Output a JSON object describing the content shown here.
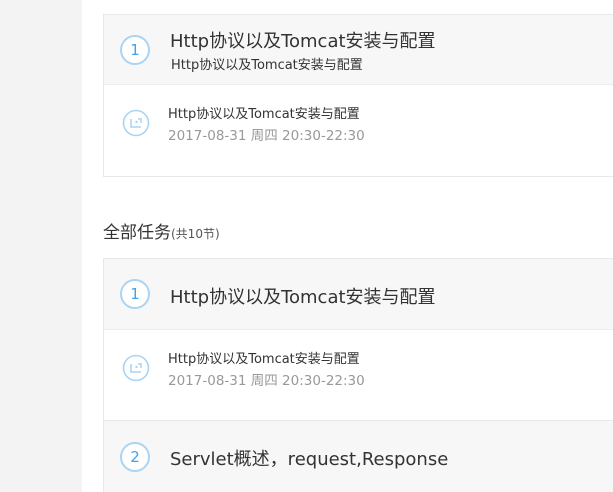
{
  "colors": {
    "accent": "#43a2e8",
    "circle_border": "#a9d4f4",
    "muted_text": "#999999",
    "header_bg": "#f7f7f7",
    "rail_bg": "#f3f3f3"
  },
  "top_card": {
    "number": "1",
    "title": "Http协议以及Tomcat安装与配置",
    "subtitle": "Http协议以及Tomcat安装与配置",
    "task": {
      "icon": "live-lesson-icon",
      "name": "Http协议以及Tomcat安装与配置",
      "time": "2017-08-31 周四 20:30-22:30"
    }
  },
  "all_tasks": {
    "title": "全部任务",
    "count": "(共10节)"
  },
  "chapters": [
    {
      "number": "1",
      "title": "Http协议以及Tomcat安装与配置",
      "task": {
        "icon": "live-lesson-icon",
        "name": "Http协议以及Tomcat安装与配置",
        "time": "2017-08-31 周四 20:30-22:30"
      }
    },
    {
      "number": "2",
      "title": "Servlet概述，request,Response"
    }
  ]
}
